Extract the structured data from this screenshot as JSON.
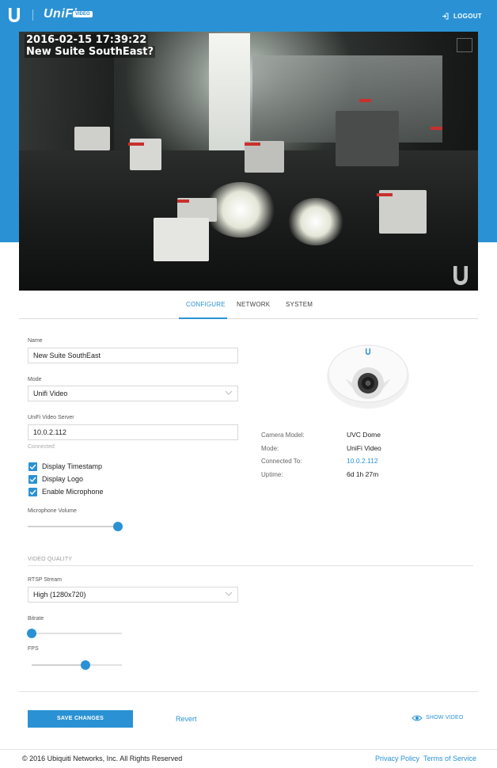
{
  "header": {
    "brand": "UniFi",
    "brand_badge": "VIDEO",
    "logout_label": "LOGOUT",
    "colors": {
      "accent": "#2a92d4"
    }
  },
  "video": {
    "timestamp": "2016-02-15 17:39:22",
    "camera_name_overlay": "New Suite SouthEast?"
  },
  "tabs": [
    {
      "label": "CONFIGURE",
      "active": true
    },
    {
      "label": "NETWORK",
      "active": false
    },
    {
      "label": "SYSTEM",
      "active": false
    }
  ],
  "form": {
    "name_label": "Name",
    "name_value": "New Suite SouthEast",
    "mode_label": "Mode",
    "mode_value": "Unifi Video",
    "server_label": "UniFi Video Server",
    "server_value": "10.0.2.112",
    "server_status": "Connected",
    "checkboxes": [
      {
        "label": "Display Timestamp",
        "checked": true
      },
      {
        "label": "Display Logo",
        "checked": true
      },
      {
        "label": "Enable Microphone",
        "checked": true
      }
    ],
    "mic_volume_label": "Microphone Volume",
    "mic_volume_fraction": 1.0
  },
  "camera_info": {
    "rows": [
      {
        "key": "Camera Model:",
        "value": "UVC Dome",
        "link": false
      },
      {
        "key": "Mode:",
        "value": "UniFi Video",
        "link": false
      },
      {
        "key": "Connected To:",
        "value": "10.0.2.112",
        "link": true
      },
      {
        "key": "Uptime:",
        "value": "6d 1h 27m",
        "link": false
      }
    ]
  },
  "video_quality": {
    "section_title": "VIDEO QUALITY",
    "rtsp_label": "RTSP Stream",
    "rtsp_value": "High (1280x720)",
    "bitrate_label": "Bitrate",
    "bitrate_fraction": 0.0,
    "fps_label": "FPS",
    "fps_fraction": 0.6
  },
  "actions": {
    "save_label": "SAVE CHANGES",
    "revert_label": "Revert",
    "show_video_label": "SHOW VIDEO"
  },
  "footer": {
    "copyright": "© 2016 Ubiquiti Networks, Inc. All Rights Reserved",
    "privacy": "Privacy Policy",
    "terms": "Terms of Service"
  }
}
